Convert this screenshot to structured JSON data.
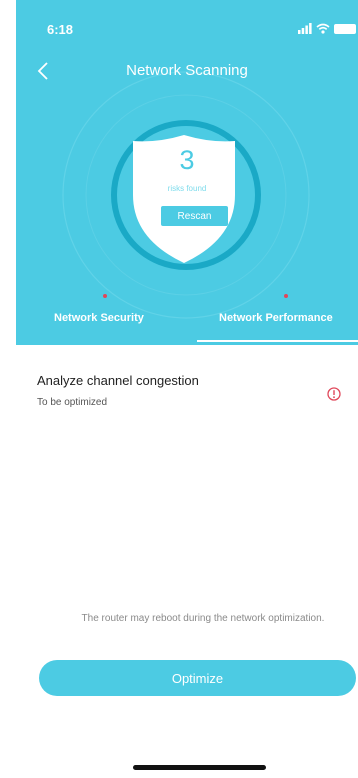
{
  "status_bar": {
    "time": "6:18",
    "icons": [
      "signal-icon",
      "wifi-icon",
      "battery-icon"
    ]
  },
  "header": {
    "title": "Network Scanning",
    "back_icon": "chevron-left-icon"
  },
  "scan": {
    "risk_count": "3",
    "risk_label": "risks found",
    "rescan_label": "Rescan"
  },
  "tabs": [
    {
      "label": "Network Security",
      "has_alert": true,
      "active": false
    },
    {
      "label": "Network Performance",
      "has_alert": true,
      "active": true
    }
  ],
  "items": [
    {
      "title": "Analyze channel congestion",
      "status": "To be optimized",
      "icon": "warning-icon"
    }
  ],
  "footer": {
    "note": "The router may reboot during the network optimization.",
    "optimize_label": "Optimize"
  },
  "colors": {
    "accent": "#4ccbe3",
    "alert": "#e0475a",
    "text": "#222222",
    "muted": "#8a8a8a"
  }
}
